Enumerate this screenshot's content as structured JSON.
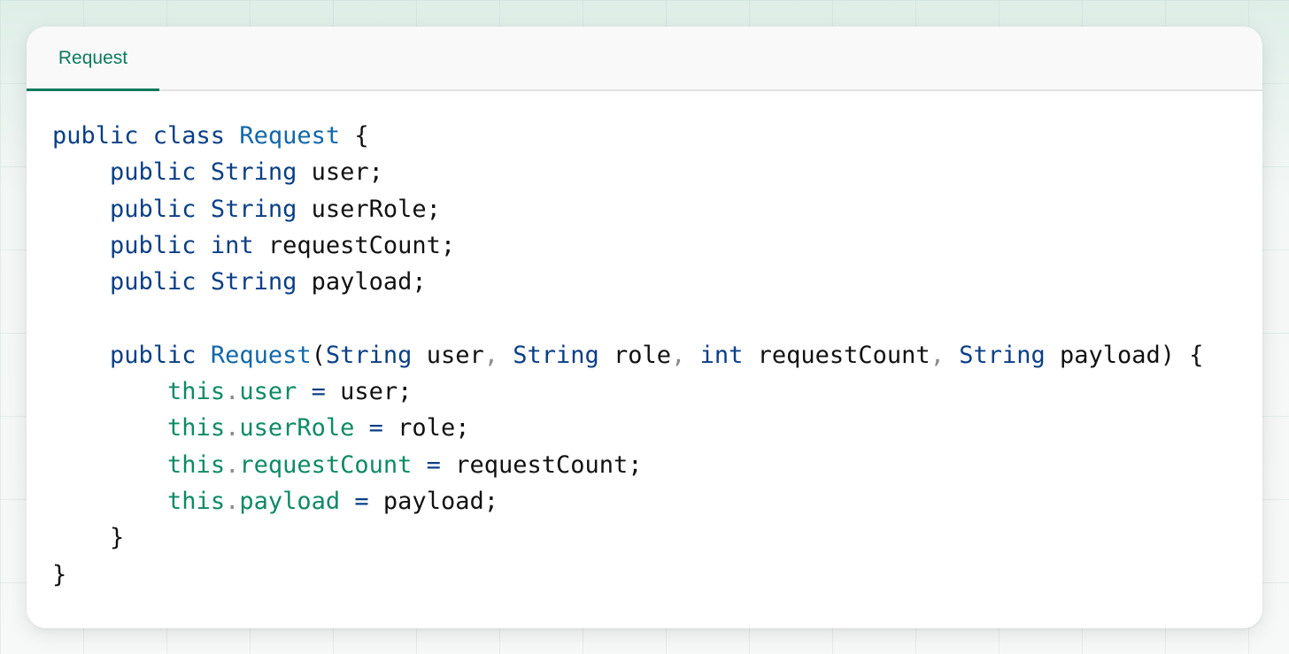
{
  "tab": {
    "label": "Request"
  },
  "code": {
    "lines": [
      [
        {
          "t": "public class ",
          "c": "kw"
        },
        {
          "t": "Request",
          "c": "ty"
        },
        {
          "t": " {",
          "c": "plain"
        }
      ],
      [
        {
          "t": "    ",
          "c": "plain"
        },
        {
          "t": "public ",
          "c": "kw"
        },
        {
          "t": "String",
          "c": "kw"
        },
        {
          "t": " user;",
          "c": "plain"
        }
      ],
      [
        {
          "t": "    ",
          "c": "plain"
        },
        {
          "t": "public ",
          "c": "kw"
        },
        {
          "t": "String",
          "c": "kw"
        },
        {
          "t": " userRole;",
          "c": "plain"
        }
      ],
      [
        {
          "t": "    ",
          "c": "plain"
        },
        {
          "t": "public ",
          "c": "kw"
        },
        {
          "t": "int",
          "c": "kw"
        },
        {
          "t": " requestCount;",
          "c": "plain"
        }
      ],
      [
        {
          "t": "    ",
          "c": "plain"
        },
        {
          "t": "public ",
          "c": "kw"
        },
        {
          "t": "String",
          "c": "kw"
        },
        {
          "t": " payload;",
          "c": "plain"
        }
      ],
      [
        {
          "t": "",
          "c": "plain"
        }
      ],
      [
        {
          "t": "    ",
          "c": "plain"
        },
        {
          "t": "public ",
          "c": "kw"
        },
        {
          "t": "Request",
          "c": "ty"
        },
        {
          "t": "(",
          "c": "plain"
        },
        {
          "t": "String",
          "c": "kw"
        },
        {
          "t": " user",
          "c": "plain"
        },
        {
          "t": ", ",
          "c": "pun"
        },
        {
          "t": "String",
          "c": "kw"
        },
        {
          "t": " role",
          "c": "plain"
        },
        {
          "t": ", ",
          "c": "pun"
        },
        {
          "t": "int",
          "c": "kw"
        },
        {
          "t": " requestCount",
          "c": "plain"
        },
        {
          "t": ", ",
          "c": "pun"
        },
        {
          "t": "String",
          "c": "kw"
        },
        {
          "t": " payload) {",
          "c": "plain"
        }
      ],
      [
        {
          "t": "        ",
          "c": "plain"
        },
        {
          "t": "this",
          "c": "fld"
        },
        {
          "t": ".",
          "c": "pun"
        },
        {
          "t": "user",
          "c": "fld"
        },
        {
          "t": " = ",
          "c": "kw"
        },
        {
          "t": "user;",
          "c": "plain"
        }
      ],
      [
        {
          "t": "        ",
          "c": "plain"
        },
        {
          "t": "this",
          "c": "fld"
        },
        {
          "t": ".",
          "c": "pun"
        },
        {
          "t": "userRole",
          "c": "fld"
        },
        {
          "t": " = ",
          "c": "kw"
        },
        {
          "t": "role;",
          "c": "plain"
        }
      ],
      [
        {
          "t": "        ",
          "c": "plain"
        },
        {
          "t": "this",
          "c": "fld"
        },
        {
          "t": ".",
          "c": "pun"
        },
        {
          "t": "requestCount",
          "c": "fld"
        },
        {
          "t": " = ",
          "c": "kw"
        },
        {
          "t": "requestCount;",
          "c": "plain"
        }
      ],
      [
        {
          "t": "        ",
          "c": "plain"
        },
        {
          "t": "this",
          "c": "fld"
        },
        {
          "t": ".",
          "c": "pun"
        },
        {
          "t": "payload",
          "c": "fld"
        },
        {
          "t": " = ",
          "c": "kw"
        },
        {
          "t": "payload;",
          "c": "plain"
        }
      ],
      [
        {
          "t": "    }",
          "c": "plain"
        }
      ],
      [
        {
          "t": "}",
          "c": "plain"
        }
      ]
    ]
  },
  "colors": {
    "accent": "#0d7a5c",
    "keyword": "#0b3f86",
    "type": "#1167aa",
    "field": "#0d8a66",
    "text": "#111111"
  }
}
